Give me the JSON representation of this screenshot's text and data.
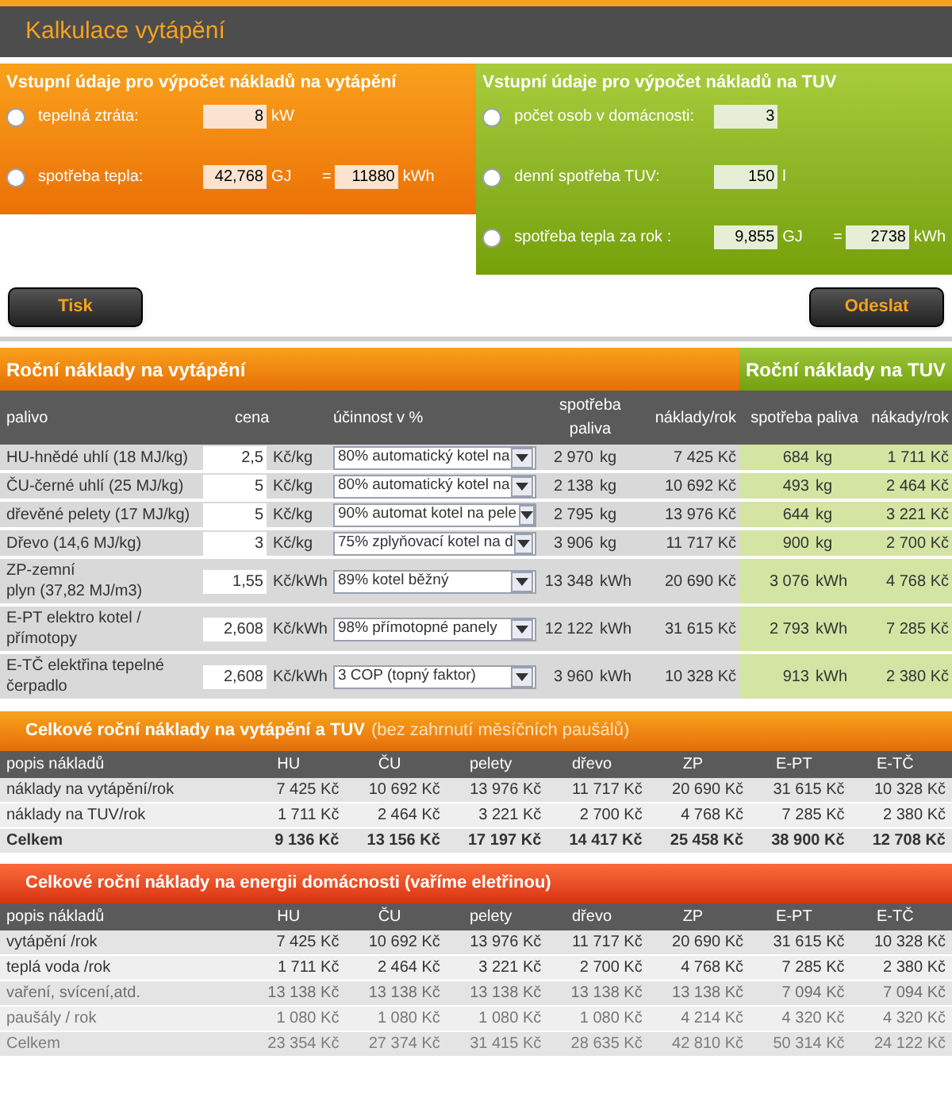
{
  "title": "Kalkulace vytápění",
  "heating_inputs": {
    "title": "Vstupní údaje pro výpočet nákladů na vytápění",
    "rows": [
      {
        "label": "tepelná ztráta:",
        "selected": false,
        "value": "8",
        "unit": "kW"
      },
      {
        "label": "spotřeba tepla:",
        "selected": false,
        "value": "42,768",
        "unit": "GJ",
        "equals": "=",
        "value2": "11880",
        "unit2": "kWh"
      }
    ]
  },
  "tuv_inputs": {
    "title": "Vstupní údaje pro výpočet nákladů na TUV",
    "rows": [
      {
        "label": "počet osob v domácnosti:",
        "selected": false,
        "value": "3"
      },
      {
        "label": "denní spotřeba TUV:",
        "selected": false,
        "value": "150",
        "unit": "l"
      },
      {
        "label": "spotřeba tepla za rok :",
        "selected": false,
        "value": "9,855",
        "unit": "GJ",
        "equals": "=",
        "value2": "2738",
        "unit2": "kWh"
      }
    ]
  },
  "buttons": [
    "Tisk",
    "Odeslat"
  ],
  "costs": {
    "heating_title": "Roční náklady na vytápění",
    "tuv_title": "Roční náklady na TUV",
    "columns": [
      "palivo",
      "cena",
      "účinnost v %",
      "spotřeba paliva",
      "náklady/rok",
      "spotřeba paliva",
      "nákady/rok"
    ],
    "rows": [
      {
        "fuel": [
          "HU-hnědé uhlí (18 MJ/kg)"
        ],
        "price": "2,5",
        "price_unit": "Kč/kg",
        "efficiency": "80% automatický kotel na",
        "consumption": "2 970",
        "unit": "kg",
        "cost": "7 425 Kč",
        "tuv_consumption": "684",
        "tuv_unit": "kg",
        "tuv_cost": "1 711 Kč"
      },
      {
        "fuel": [
          "ČU-černé uhlí (25 MJ/kg)"
        ],
        "price": "5",
        "price_unit": "Kč/kg",
        "efficiency": "80% automatický kotel na",
        "consumption": "2 138",
        "unit": "kg",
        "cost": "10 692 Kč",
        "tuv_consumption": "493",
        "tuv_unit": "kg",
        "tuv_cost": "2 464 Kč"
      },
      {
        "fuel": [
          "dřevěné pelety (17 MJ/kg)"
        ],
        "price": "5",
        "price_unit": "Kč/kg",
        "efficiency": "90% automat kotel na pele",
        "consumption": "2 795",
        "unit": "kg",
        "cost": "13 976 Kč",
        "tuv_consumption": "644",
        "tuv_unit": "kg",
        "tuv_cost": "3 221 Kč"
      },
      {
        "fuel": [
          "Dřevo (14,6 MJ/kg)"
        ],
        "price": "3",
        "price_unit": "Kč/kg",
        "efficiency": "75% zplyňovací kotel na d",
        "consumption": "3 906",
        "unit": "kg",
        "cost": "11 717 Kč",
        "tuv_consumption": "900",
        "tuv_unit": "kg",
        "tuv_cost": "2 700 Kč"
      },
      {
        "fuel": [
          "ZP-zemní",
          "plyn (37,82 MJ/m3)"
        ],
        "price": "1,55",
        "price_unit": "Kč/kWh",
        "efficiency": "89% kotel běžný",
        "consumption": "13 348",
        "unit": "kWh",
        "cost": "20 690 Kč",
        "tuv_consumption": "3 076",
        "tuv_unit": "kWh",
        "tuv_cost": "4 768 Kč"
      },
      {
        "fuel": [
          "E-PT elektro kotel /",
          "přímotopy"
        ],
        "price": "2,608",
        "price_unit": "Kč/kWh",
        "efficiency": "98% přímotopné panely",
        "consumption": "12 122",
        "unit": "kWh",
        "cost": "31 615 Kč",
        "tuv_consumption": "2 793",
        "tuv_unit": "kWh",
        "tuv_cost": "7 285 Kč"
      },
      {
        "fuel": [
          "E-TČ elektřina tepelné",
          "čerpadlo"
        ],
        "price": "2,608",
        "price_unit": "Kč/kWh",
        "efficiency": "3 COP (topný faktor)",
        "consumption": "3 960",
        "unit": "kWh",
        "cost": "10 328 Kč",
        "tuv_consumption": "913",
        "tuv_unit": "kWh",
        "tuv_cost": "2 380 Kč"
      }
    ]
  },
  "summaries": [
    {
      "title": "Celkové roční náklady na vytápění a TUV",
      "subtitle": "(bez zahrnutí měsíčních paušálů)",
      "kind": "orange",
      "columns": [
        "popis nákladů",
        "HU",
        "ČU",
        "pelety",
        "dřevo",
        "ZP",
        "E-PT",
        "E-TČ"
      ],
      "rows": [
        {
          "bold": false,
          "cells": [
            "náklady na vytápění/rok",
            "7 425 Kč",
            "10 692 Kč",
            "13 976 Kč",
            "11 717 Kč",
            "20 690 Kč",
            "31 615 Kč",
            "10 328 Kč"
          ]
        },
        {
          "bold": false,
          "cells": [
            "náklady na TUV/rok",
            "1 711 Kč",
            "2 464 Kč",
            "3 221 Kč",
            "2 700 Kč",
            "4 768 Kč",
            "7 285 Kč",
            "2 380 Kč"
          ]
        },
        {
          "bold": true,
          "cells": [
            "Celkem",
            "9 136 Kč",
            "13 156 Kč",
            "17 197 Kč",
            "14 417 Kč",
            "25 458 Kč",
            "38 900 Kč",
            "12 708 Kč"
          ]
        }
      ]
    },
    {
      "title": "Celkové roční náklady na energii domácnosti (vaříme eletřinou)",
      "kind": "red",
      "columns": [
        "popis nákladů",
        "HU",
        "ČU",
        "pelety",
        "dřevo",
        "ZP",
        "E-PT",
        "E-TČ"
      ],
      "rows": [
        {
          "bold": false,
          "cells": [
            "vytápění /rok",
            "7 425 Kč",
            "10 692 Kč",
            "13 976 Kč",
            "11 717 Kč",
            "20 690 Kč",
            "31 615 Kč",
            "10 328 Kč"
          ]
        },
        {
          "bold": false,
          "cells": [
            "teplá voda /rok",
            "1 711 Kč",
            "2 464 Kč",
            "3 221 Kč",
            "2 700 Kč",
            "4 768 Kč",
            "7 285 Kč",
            "2 380 Kč"
          ]
        },
        {
          "bold": false,
          "cells": [
            "vaření, svícení,atd.",
            "13 138 Kč",
            "13 138 Kč",
            "13 138 Kč",
            "13 138 Kč",
            "13 138 Kč",
            "7 094 Kč",
            "7 094 Kč"
          ]
        },
        {
          "bold": false,
          "cells": [
            "paušály / rok",
            "1 080 Kč",
            "1 080 Kč",
            "1 080 Kč",
            "1 080 Kč",
            "4 214 Kč",
            "4 320 Kč",
            "4 320 Kč"
          ]
        },
        {
          "bold": false,
          "cells": [
            "Celkem",
            "23 354 Kč",
            "27 374 Kč",
            "31 415 Kč",
            "28 635 Kč",
            "42 810 Kč",
            "50 314 Kč",
            "24 122 Kč"
          ]
        }
      ]
    }
  ]
}
